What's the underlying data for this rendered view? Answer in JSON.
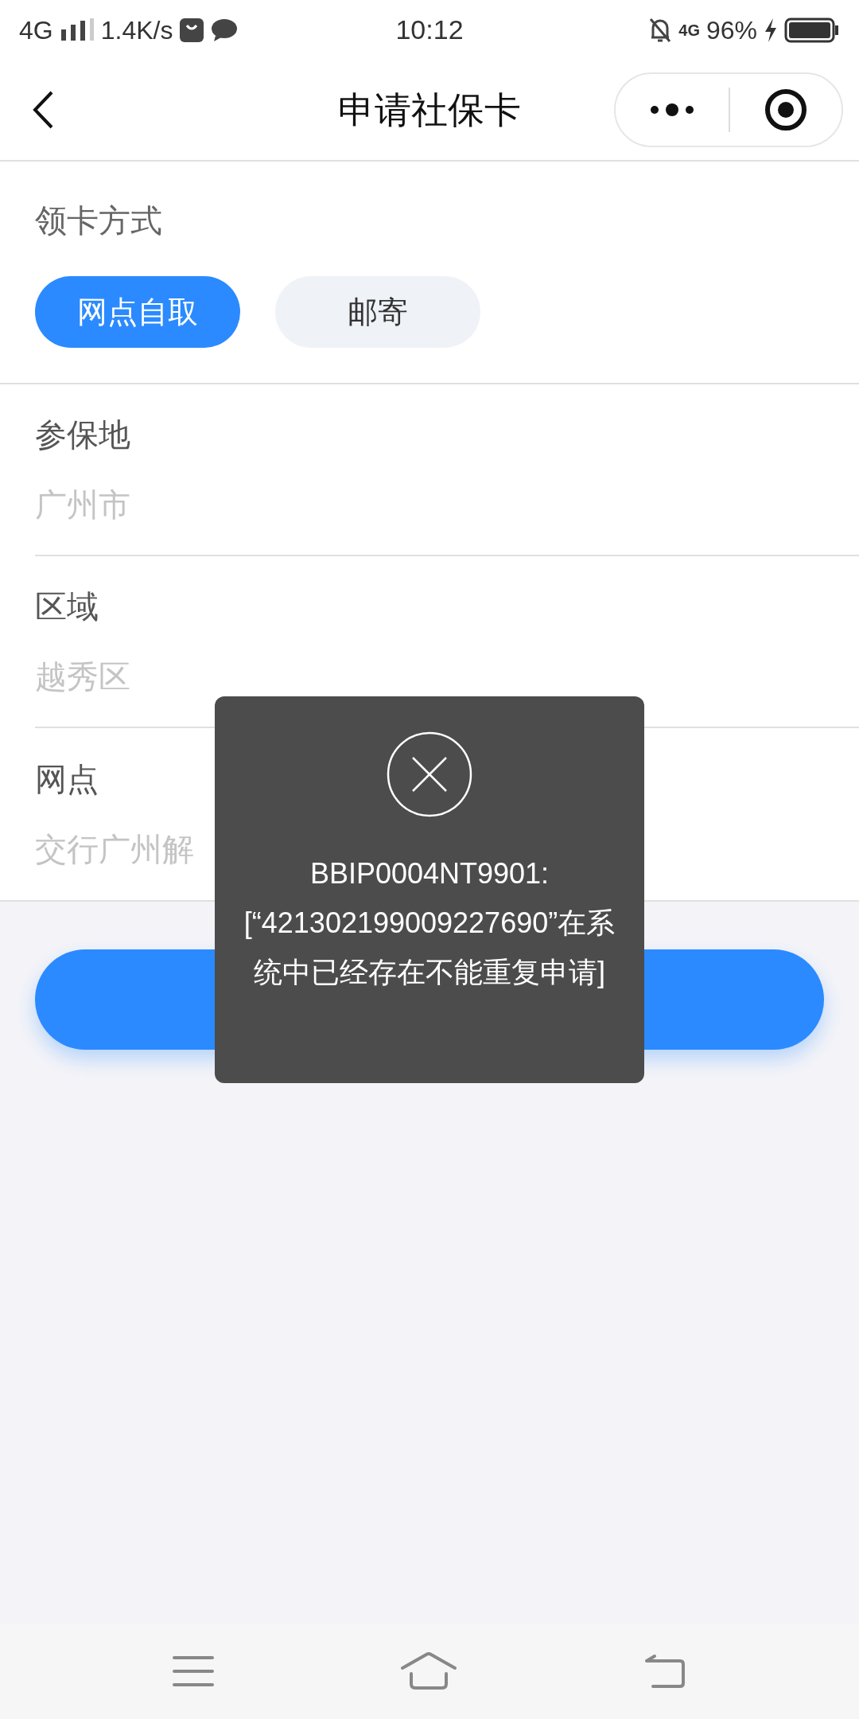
{
  "status_bar": {
    "network": "4G",
    "speed": "1.4K/s",
    "time": "10:12",
    "network_right": "4G",
    "battery": "96%"
  },
  "nav": {
    "title": "申请社保卡"
  },
  "pickup": {
    "label": "领卡方式",
    "options": [
      {
        "label": "网点自取",
        "selected": true
      },
      {
        "label": "邮寄",
        "selected": false
      }
    ]
  },
  "fields": [
    {
      "label": "参保地",
      "placeholder": "广州市"
    },
    {
      "label": "区域",
      "placeholder": "越秀区"
    },
    {
      "label": "网点",
      "placeholder": "交行广州解"
    }
  ],
  "toast": {
    "message": "BBIP0004NT9901: [“421302199009227690”在系统中已经存在不能重复申请]"
  }
}
